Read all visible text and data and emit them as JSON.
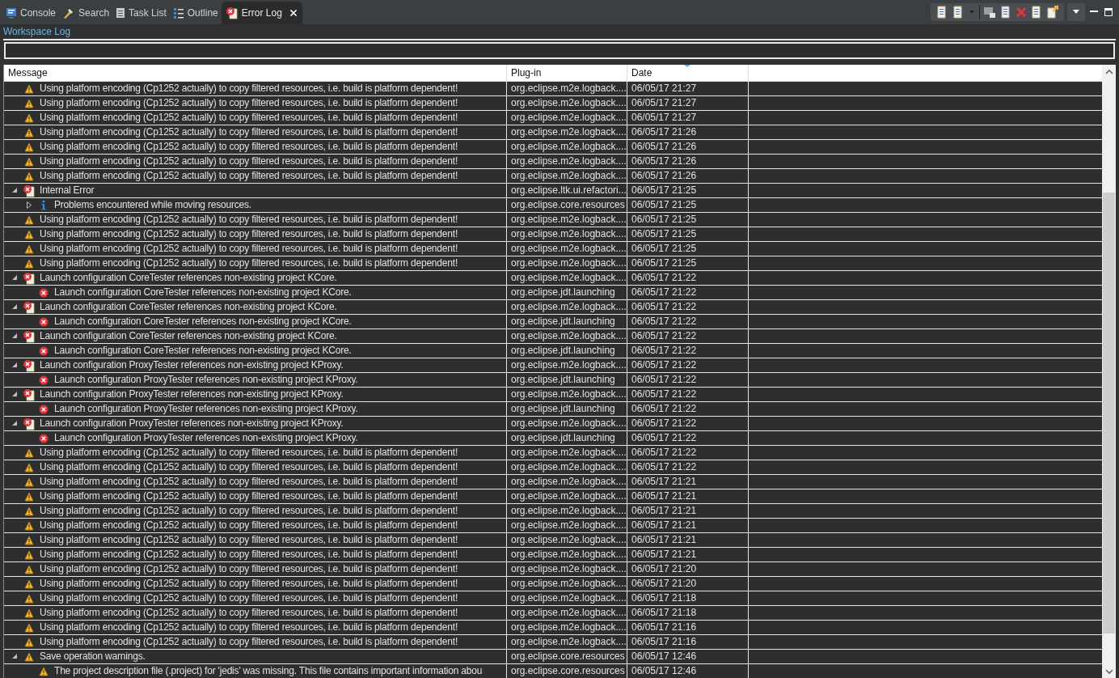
{
  "tabs": [
    {
      "label": "Console",
      "kind": "console",
      "selected": false
    },
    {
      "label": "Search",
      "kind": "search",
      "selected": false
    },
    {
      "label": "Task List",
      "kind": "tasks",
      "selected": false
    },
    {
      "label": "Outline",
      "kind": "outline",
      "selected": false
    },
    {
      "label": "Error Log",
      "kind": "errorlog",
      "selected": true,
      "closable": true
    }
  ],
  "log_title": "Workspace Log",
  "columns": [
    {
      "label": "Message",
      "sorted": false
    },
    {
      "label": "Plug-in",
      "sorted": false
    },
    {
      "label": "Date",
      "sorted": true
    }
  ],
  "entries": [
    {
      "kind": "warning",
      "message": "Using platform encoding (Cp1252 actually) to copy filtered resources, i.e. build is platform dependent!",
      "plugin": "org.eclipse.m2e.logback....",
      "date": "06/05/17 21:27"
    },
    {
      "kind": "warning",
      "message": "Using platform encoding (Cp1252 actually) to copy filtered resources, i.e. build is platform dependent!",
      "plugin": "org.eclipse.m2e.logback....",
      "date": "06/05/17 21:27"
    },
    {
      "kind": "warning",
      "message": "Using platform encoding (Cp1252 actually) to copy filtered resources, i.e. build is platform dependent!",
      "plugin": "org.eclipse.m2e.logback....",
      "date": "06/05/17 21:27"
    },
    {
      "kind": "warning",
      "message": "Using platform encoding (Cp1252 actually) to copy filtered resources, i.e. build is platform dependent!",
      "plugin": "org.eclipse.m2e.logback....",
      "date": "06/05/17 21:26"
    },
    {
      "kind": "warning",
      "message": "Using platform encoding (Cp1252 actually) to copy filtered resources, i.e. build is platform dependent!",
      "plugin": "org.eclipse.m2e.logback....",
      "date": "06/05/17 21:26"
    },
    {
      "kind": "warning",
      "message": "Using platform encoding (Cp1252 actually) to copy filtered resources, i.e. build is platform dependent!",
      "plugin": "org.eclipse.m2e.logback....",
      "date": "06/05/17 21:26"
    },
    {
      "kind": "warning",
      "message": "Using platform encoding (Cp1252 actually) to copy filtered resources, i.e. build is platform dependent!",
      "plugin": "org.eclipse.m2e.logback....",
      "date": "06/05/17 21:26"
    },
    {
      "kind": "error-log",
      "message": "Internal Error",
      "plugin": "org.eclipse.ltk.ui.refactori...",
      "date": "06/05/17 21:25",
      "expanded": true,
      "children": [
        {
          "kind": "info",
          "message": "Problems encountered while moving resources.",
          "plugin": "org.eclipse.core.resources",
          "date": "06/05/17 21:25",
          "expanded": false
        }
      ]
    },
    {
      "kind": "warning",
      "message": "Using platform encoding (Cp1252 actually) to copy filtered resources, i.e. build is platform dependent!",
      "plugin": "org.eclipse.m2e.logback....",
      "date": "06/05/17 21:25"
    },
    {
      "kind": "warning",
      "message": "Using platform encoding (Cp1252 actually) to copy filtered resources, i.e. build is platform dependent!",
      "plugin": "org.eclipse.m2e.logback....",
      "date": "06/05/17 21:25"
    },
    {
      "kind": "warning",
      "message": "Using platform encoding (Cp1252 actually) to copy filtered resources, i.e. build is platform dependent!",
      "plugin": "org.eclipse.m2e.logback....",
      "date": "06/05/17 21:25"
    },
    {
      "kind": "warning",
      "message": "Using platform encoding (Cp1252 actually) to copy filtered resources, i.e. build is platform dependent!",
      "plugin": "org.eclipse.m2e.logback....",
      "date": "06/05/17 21:25"
    },
    {
      "kind": "error-log",
      "message": "Launch configuration CoreTester references non-existing project KCore.",
      "plugin": "org.eclipse.m2e.logback....",
      "date": "06/05/17 21:22",
      "expanded": true,
      "children": [
        {
          "kind": "error",
          "message": "Launch configuration CoreTester references non-existing project KCore.",
          "plugin": "org.eclipse.jdt.launching",
          "date": "06/05/17 21:22"
        }
      ]
    },
    {
      "kind": "error-log",
      "message": "Launch configuration CoreTester references non-existing project KCore.",
      "plugin": "org.eclipse.m2e.logback....",
      "date": "06/05/17 21:22",
      "expanded": true,
      "children": [
        {
          "kind": "error",
          "message": "Launch configuration CoreTester references non-existing project KCore.",
          "plugin": "org.eclipse.jdt.launching",
          "date": "06/05/17 21:22"
        }
      ]
    },
    {
      "kind": "error-log",
      "message": "Launch configuration CoreTester references non-existing project KCore.",
      "plugin": "org.eclipse.m2e.logback....",
      "date": "06/05/17 21:22",
      "expanded": true,
      "children": [
        {
          "kind": "error",
          "message": "Launch configuration CoreTester references non-existing project KCore.",
          "plugin": "org.eclipse.jdt.launching",
          "date": "06/05/17 21:22"
        }
      ]
    },
    {
      "kind": "error-log",
      "message": "Launch configuration ProxyTester references non-existing project KProxy.",
      "plugin": "org.eclipse.m2e.logback....",
      "date": "06/05/17 21:22",
      "expanded": true,
      "children": [
        {
          "kind": "error",
          "message": "Launch configuration ProxyTester references non-existing project KProxy.",
          "plugin": "org.eclipse.jdt.launching",
          "date": "06/05/17 21:22"
        }
      ]
    },
    {
      "kind": "error-log",
      "message": "Launch configuration ProxyTester references non-existing project KProxy.",
      "plugin": "org.eclipse.m2e.logback....",
      "date": "06/05/17 21:22",
      "expanded": true,
      "children": [
        {
          "kind": "error",
          "message": "Launch configuration ProxyTester references non-existing project KProxy.",
          "plugin": "org.eclipse.jdt.launching",
          "date": "06/05/17 21:22"
        }
      ]
    },
    {
      "kind": "error-log",
      "message": "Launch configuration ProxyTester references non-existing project KProxy.",
      "plugin": "org.eclipse.m2e.logback....",
      "date": "06/05/17 21:22",
      "expanded": true,
      "children": [
        {
          "kind": "error",
          "message": "Launch configuration ProxyTester references non-existing project KProxy.",
          "plugin": "org.eclipse.jdt.launching",
          "date": "06/05/17 21:22"
        }
      ]
    },
    {
      "kind": "warning",
      "message": "Using platform encoding (Cp1252 actually) to copy filtered resources, i.e. build is platform dependent!",
      "plugin": "org.eclipse.m2e.logback....",
      "date": "06/05/17 21:22"
    },
    {
      "kind": "warning",
      "message": "Using platform encoding (Cp1252 actually) to copy filtered resources, i.e. build is platform dependent!",
      "plugin": "org.eclipse.m2e.logback....",
      "date": "06/05/17 21:22"
    },
    {
      "kind": "warning",
      "message": "Using platform encoding (Cp1252 actually) to copy filtered resources, i.e. build is platform dependent!",
      "plugin": "org.eclipse.m2e.logback....",
      "date": "06/05/17 21:21"
    },
    {
      "kind": "warning",
      "message": "Using platform encoding (Cp1252 actually) to copy filtered resources, i.e. build is platform dependent!",
      "plugin": "org.eclipse.m2e.logback....",
      "date": "06/05/17 21:21"
    },
    {
      "kind": "warning",
      "message": "Using platform encoding (Cp1252 actually) to copy filtered resources, i.e. build is platform dependent!",
      "plugin": "org.eclipse.m2e.logback....",
      "date": "06/05/17 21:21"
    },
    {
      "kind": "warning",
      "message": "Using platform encoding (Cp1252 actually) to copy filtered resources, i.e. build is platform dependent!",
      "plugin": "org.eclipse.m2e.logback....",
      "date": "06/05/17 21:21"
    },
    {
      "kind": "warning",
      "message": "Using platform encoding (Cp1252 actually) to copy filtered resources, i.e. build is platform dependent!",
      "plugin": "org.eclipse.m2e.logback....",
      "date": "06/05/17 21:21"
    },
    {
      "kind": "warning",
      "message": "Using platform encoding (Cp1252 actually) to copy filtered resources, i.e. build is platform dependent!",
      "plugin": "org.eclipse.m2e.logback....",
      "date": "06/05/17 21:21"
    },
    {
      "kind": "warning",
      "message": "Using platform encoding (Cp1252 actually) to copy filtered resources, i.e. build is platform dependent!",
      "plugin": "org.eclipse.m2e.logback....",
      "date": "06/05/17 21:20"
    },
    {
      "kind": "warning",
      "message": "Using platform encoding (Cp1252 actually) to copy filtered resources, i.e. build is platform dependent!",
      "plugin": "org.eclipse.m2e.logback....",
      "date": "06/05/17 21:20"
    },
    {
      "kind": "warning",
      "message": "Using platform encoding (Cp1252 actually) to copy filtered resources, i.e. build is platform dependent!",
      "plugin": "org.eclipse.m2e.logback....",
      "date": "06/05/17 21:18"
    },
    {
      "kind": "warning",
      "message": "Using platform encoding (Cp1252 actually) to copy filtered resources, i.e. build is platform dependent!",
      "plugin": "org.eclipse.m2e.logback....",
      "date": "06/05/17 21:18"
    },
    {
      "kind": "warning",
      "message": "Using platform encoding (Cp1252 actually) to copy filtered resources, i.e. build is platform dependent!",
      "plugin": "org.eclipse.m2e.logback....",
      "date": "06/05/17 21:16"
    },
    {
      "kind": "warning",
      "message": "Using platform encoding (Cp1252 actually) to copy filtered resources, i.e. build is platform dependent!",
      "plugin": "org.eclipse.m2e.logback....",
      "date": "06/05/17 21:16"
    },
    {
      "kind": "warning",
      "message": "Save operation warnings.",
      "plugin": "org.eclipse.core.resources",
      "date": "06/05/17 12:46",
      "expanded": true,
      "children": [
        {
          "kind": "warning",
          "message": "The project description file (.project) for 'jedis' was missing.  This file contains important information abou",
          "plugin": "org.eclipse.core.resources",
          "date": "06/05/17 12:46"
        }
      ]
    }
  ]
}
